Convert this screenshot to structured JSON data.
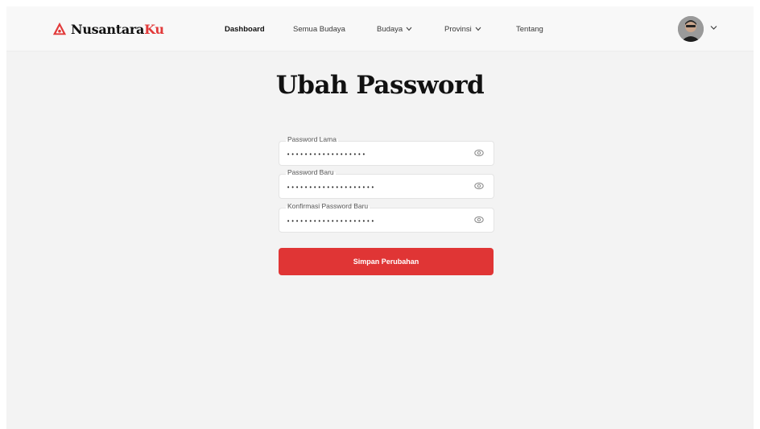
{
  "brand": {
    "name_part1": "Nusantara",
    "name_part2": "Ku"
  },
  "nav": {
    "items": [
      {
        "label": "Dashboard",
        "active": true
      },
      {
        "label": "Semua Budaya"
      },
      {
        "label": "Budaya",
        "has_dropdown": true
      },
      {
        "label": "Provinsi",
        "has_dropdown": true
      },
      {
        "label": "Tentang"
      }
    ]
  },
  "page": {
    "title": "Ubah Password"
  },
  "form": {
    "fields": [
      {
        "label": "Password Lama",
        "value": "abcdefghijklmnopqr"
      },
      {
        "label": "Password Baru",
        "value": "abcdefghijklmnopqrst"
      },
      {
        "label": "Konfirmasi Password Baru",
        "value": "abcdefghijklmnopqrst"
      }
    ],
    "submit_label": "Simpan Perubahan"
  },
  "colors": {
    "accent": "#e03535",
    "background": "#f3f3f3"
  },
  "icons": {
    "logo": "nusantaraku-logo-icon",
    "eye": "eye-icon",
    "chevron": "chevron-down-icon",
    "avatar": "avatar"
  }
}
